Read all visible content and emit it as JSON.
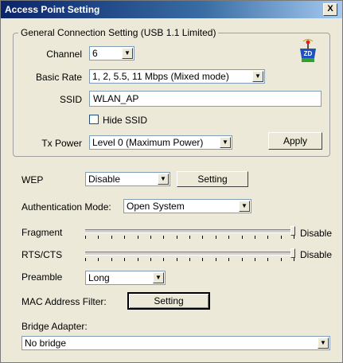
{
  "window": {
    "title": "Access Point Setting",
    "close_glyph": "X"
  },
  "general": {
    "legend": "General Connection Setting (USB 1.1 Limited)",
    "channel": {
      "label": "Channel",
      "value": "6"
    },
    "basic_rate": {
      "label": "Basic Rate",
      "value": "1, 2, 5.5, 11 Mbps (Mixed mode)"
    },
    "ssid": {
      "label": "SSID",
      "value": "WLAN_AP"
    },
    "hide_ssid": {
      "label": "Hide SSID",
      "checked": false
    },
    "tx_power": {
      "label": "Tx Power",
      "value": "Level 0 (Maximum Power)"
    },
    "apply_label": "Apply",
    "logo_icon": "zd-wireless-logo-icon"
  },
  "wep": {
    "label": "WEP",
    "value": "Disable",
    "setting_label": "Setting"
  },
  "auth": {
    "label": "Authentication Mode:",
    "value": "Open System"
  },
  "fragment": {
    "label": "Fragment",
    "value_text": "Disable"
  },
  "rts": {
    "label": "RTS/CTS",
    "value_text": "Disable"
  },
  "preamble": {
    "label": "Preamble",
    "value": "Long"
  },
  "mac_filter": {
    "label": "MAC Address Filter:",
    "setting_label": "Setting"
  },
  "bridge": {
    "label": "Bridge Adapter:",
    "value": "No bridge"
  },
  "colors": {
    "title_start": "#0a246a",
    "dialog_bg": "#ece9d8"
  }
}
